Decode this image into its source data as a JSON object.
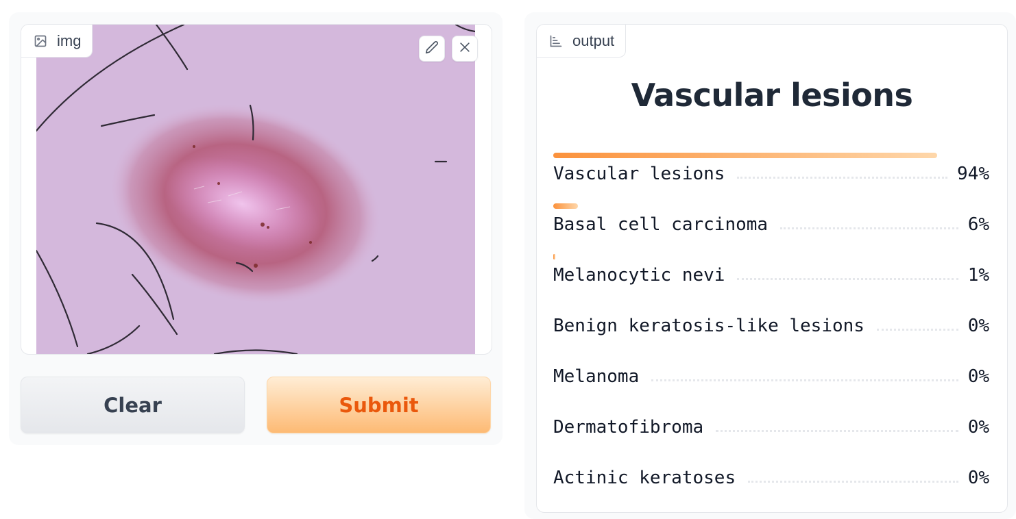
{
  "input": {
    "label": "img",
    "edit_icon": "pencil-icon",
    "close_icon": "close-icon"
  },
  "buttons": {
    "clear": "Clear",
    "submit": "Submit"
  },
  "output": {
    "label": "output",
    "label_icon": "bar-chart-icon",
    "title": "Vascular lesions",
    "confidences": [
      {
        "label": "Vascular lesions",
        "value": "94%",
        "fraction": 0.94
      },
      {
        "label": "Basal cell carcinoma",
        "value": "6%",
        "fraction": 0.06
      },
      {
        "label": "Melanocytic nevi",
        "value": "1%",
        "fraction": 0.004
      },
      {
        "label": "Benign keratosis-like lesions",
        "value": "0%",
        "fraction": 0
      },
      {
        "label": "Melanoma",
        "value": "0%",
        "fraction": 0
      },
      {
        "label": "Dermatofibroma",
        "value": "0%",
        "fraction": 0
      },
      {
        "label": "Actinic keratoses",
        "value": "0%",
        "fraction": 0
      }
    ]
  },
  "colors": {
    "accent": "#ea580c",
    "bar_start": "#fb923c",
    "bar_end": "#fed7aa"
  }
}
